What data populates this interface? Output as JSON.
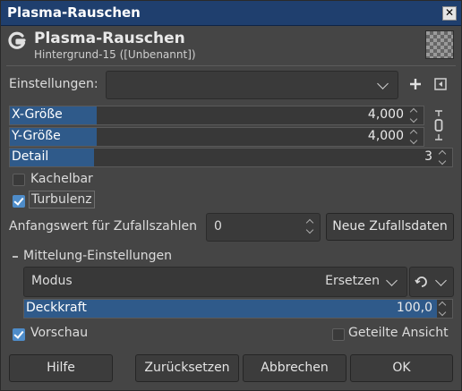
{
  "window": {
    "title": "Plasma-Rauschen",
    "close_glyph": "✕"
  },
  "header": {
    "title": "Plasma-Rauschen",
    "subtitle": "Hintergrund-15 ([Unbenannt])"
  },
  "presets": {
    "label": "Einstellungen:",
    "value": ""
  },
  "sliders": [
    {
      "name": "X-Größe",
      "value": "4,000",
      "fill_fraction": 0.21
    },
    {
      "name": "Y-Größe",
      "value": "4,000",
      "fill_fraction": 0.21
    },
    {
      "name": "Detail",
      "value": "3",
      "fill_fraction": 0.19
    }
  ],
  "kachelbar": {
    "label": "Kachelbar",
    "checked": false
  },
  "turbulenz": {
    "label": "Turbulenz",
    "checked": true
  },
  "seed": {
    "label": "Anfangswert für Zufallszahlen",
    "value": "0",
    "new_button": "Neue Zufallsdaten"
  },
  "blending": {
    "section_label": "Mittelung-Einstellungen",
    "mode_label": "Modus",
    "mode_value": "Ersetzen",
    "opacity_label": "Deckkraft",
    "opacity_value": "100,0",
    "opacity_fraction": 1.0
  },
  "preview": {
    "label": "Vorschau",
    "checked": true
  },
  "split_view": {
    "label": "Geteilte Ansicht",
    "checked": false
  },
  "buttons": {
    "help": "Hilfe",
    "reset": "Zurücksetzen",
    "cancel": "Abbrechen",
    "ok": "OK"
  }
}
